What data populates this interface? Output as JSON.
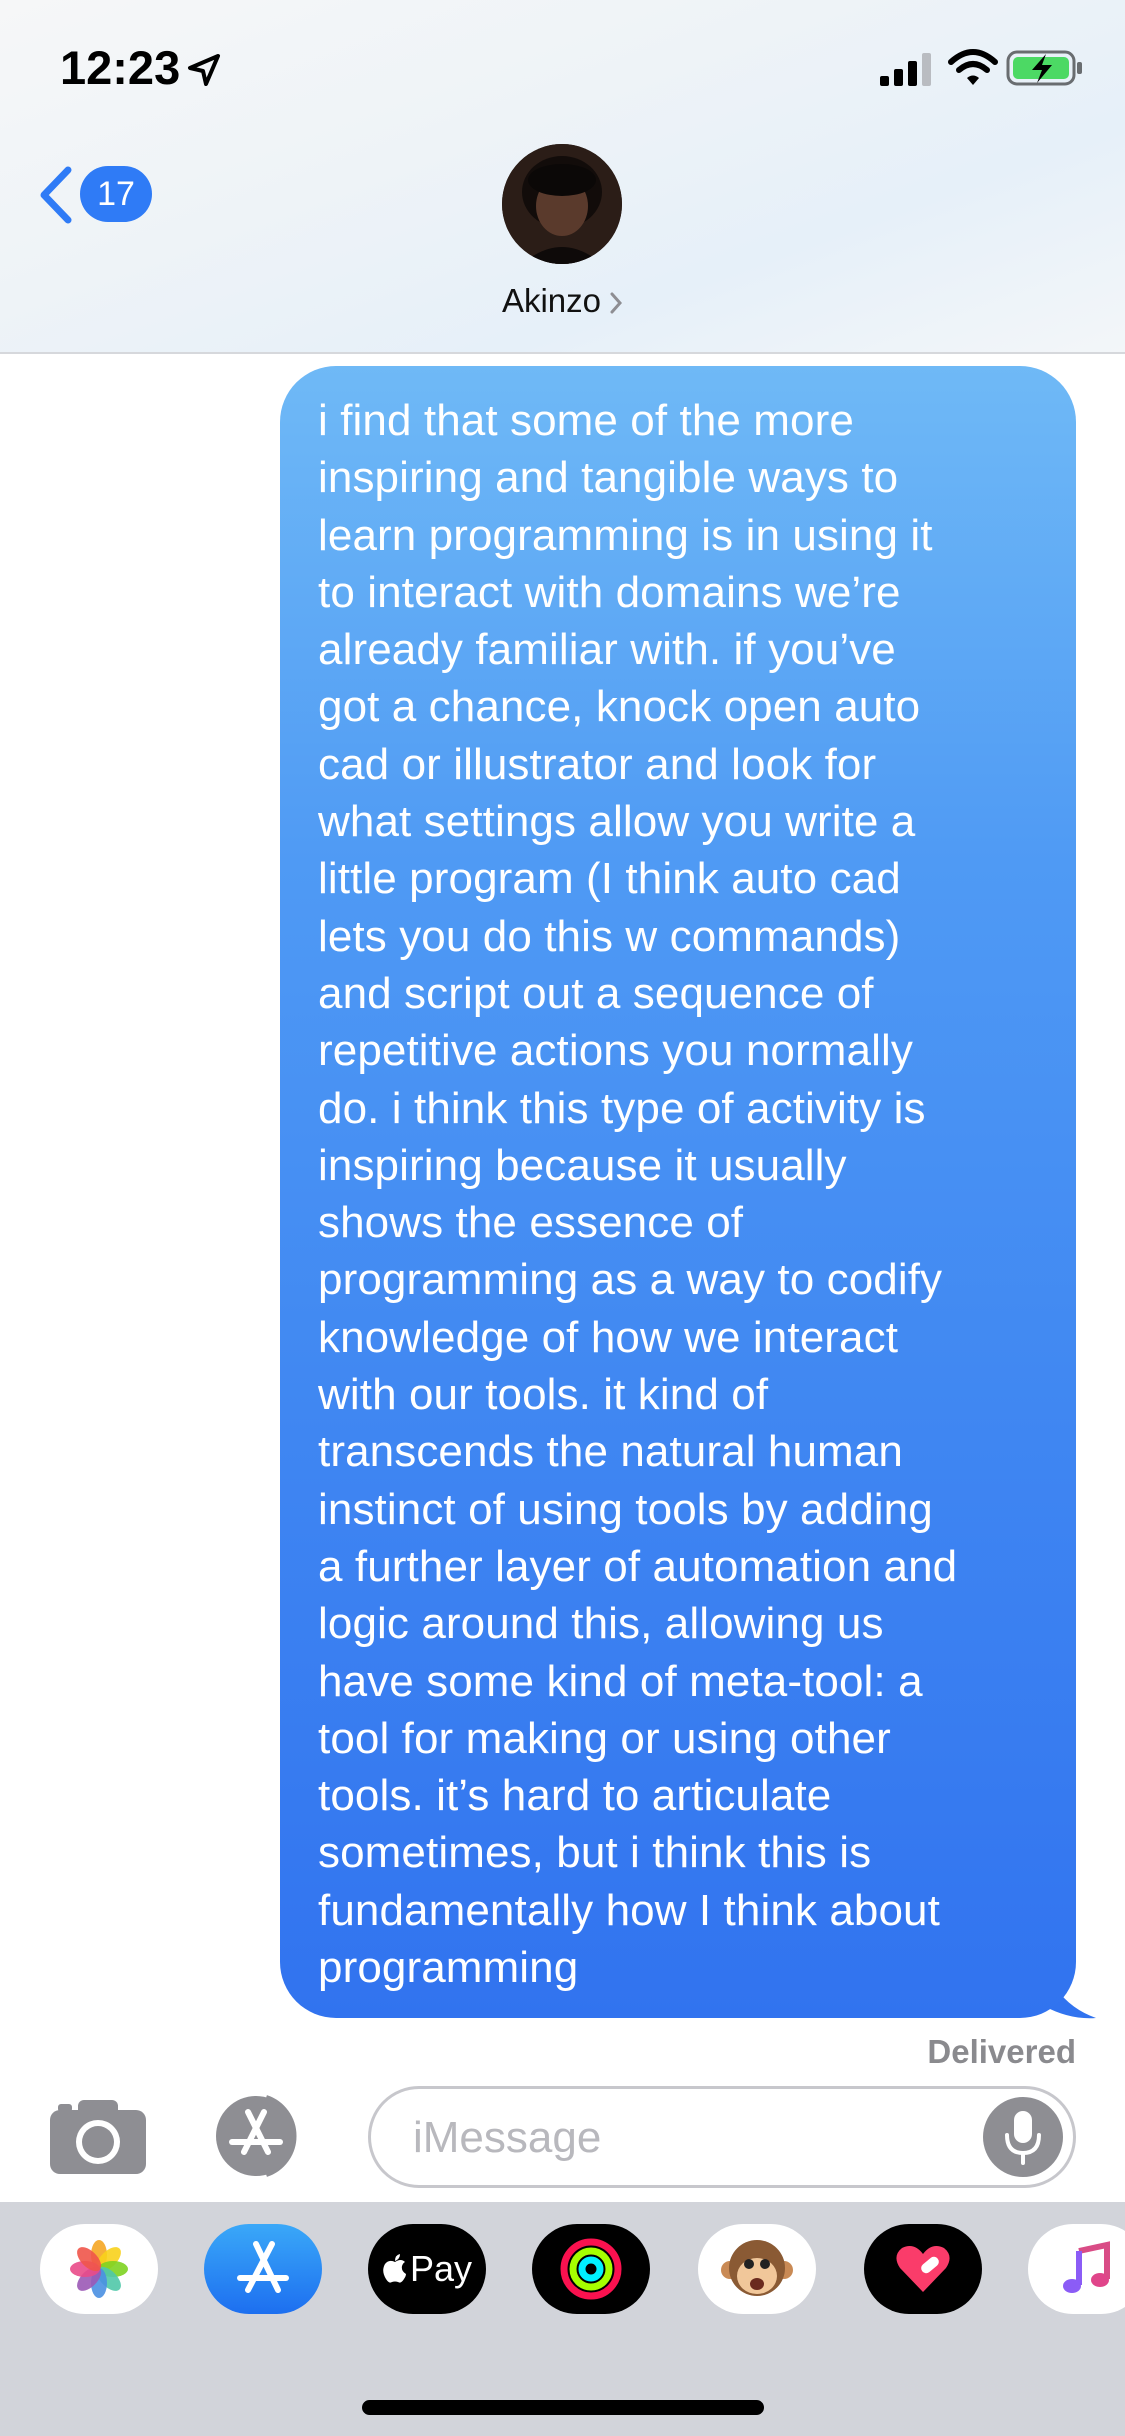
{
  "status_bar": {
    "time": "12:23",
    "icons": [
      "location-arrow-icon",
      "cellular-signal-icon",
      "wifi-icon",
      "battery-charging-icon"
    ]
  },
  "header": {
    "back_badge": "17",
    "contact_name": "Akinzo"
  },
  "message": {
    "lines": [
      "i find that some of the more",
      "inspiring and tangible ways to",
      "learn programming is in using it",
      "to interact with domains we’re",
      "already familiar with. if you’ve",
      "got a chance, knock open auto",
      "cad or illustrator and look for",
      "what settings allow you write a",
      "little program (I think auto cad",
      "lets you do this w commands)",
      "and script out a sequence of",
      "repetitive actions you normally",
      "do. i think this type of activity is",
      "inspiring because it usually",
      "shows the essence of",
      "programming as a way to codify",
      "knowledge of how we interact",
      "with our tools. it kind of",
      "transcends the natural human",
      "instinct of using tools by adding",
      "a further layer of automation and",
      "logic around this, allowing us",
      "have some kind of meta-tool: a",
      "tool for making or using other",
      "tools. it’s hard to articulate",
      "sometimes, but i think this is",
      "fundamentally how I think about",
      "programming"
    ],
    "status": "Delivered"
  },
  "composer": {
    "placeholder": "iMessage"
  },
  "app_drawer": {
    "apps": [
      {
        "name": "photos-app-icon",
        "label": ""
      },
      {
        "name": "app-store-icon",
        "label": ""
      },
      {
        "name": "apple-pay-icon",
        "label": "Pay"
      },
      {
        "name": "activity-icon",
        "label": ""
      },
      {
        "name": "animoji-monkey-icon",
        "label": ""
      },
      {
        "name": "digital-touch-icon",
        "label": ""
      },
      {
        "name": "music-icon",
        "label": ""
      }
    ]
  },
  "colors": {
    "bubble_top": "#6fb9f6",
    "bubble_bottom": "#3173ef",
    "accent_blue": "#2f7bf6",
    "drawer_bg": "#d2d4da"
  }
}
